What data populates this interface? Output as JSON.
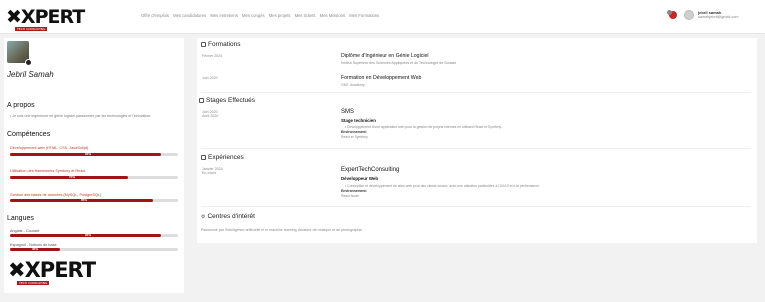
{
  "brand": {
    "logo_text": "XPERT",
    "logo_sub": "TECH CONSULTING"
  },
  "nav": {
    "items": [
      "Offre d'emplois",
      "Mes candidatures",
      "Mes entretiens",
      "Mes congés",
      "Mes projets",
      "Mes tickets",
      "Mes Missions",
      "Mes Formations"
    ]
  },
  "user": {
    "name": "jebril samah",
    "email": "samahjebril@gmail.com"
  },
  "profile": {
    "name": "Jebril Samah",
    "about_title": "A propos",
    "about_text": "Je suis une ingénieure en génie logiciel passionnée par les technologies et l'innovation.",
    "skills_title": "Compétences",
    "skills": [
      {
        "label": "Développement web (HTML, CSS, JavaScript)",
        "value": 90,
        "pct": "90%"
      },
      {
        "label": "Utilisation des frameworks Symfony et React",
        "value": 70,
        "pct": "70%"
      },
      {
        "label": "Gestion des bases de données (MySQL, PostgreSQL)",
        "value": 85,
        "pct": "85%"
      }
    ],
    "languages_title": "Langues",
    "languages": [
      {
        "label": "Anglais - Courant",
        "value": 90,
        "pct": "90%"
      },
      {
        "label": "Espagnol - Notions de base",
        "value": 30,
        "pct": "30%"
      }
    ]
  },
  "formations": {
    "title": "Formations",
    "items": [
      {
        "date": "Février 2024",
        "title": "Diplôme d'Ingénieur en Génie Logiciel",
        "place": "Institut Supérieur des Sciences Appliquées et de Technologie de Sousse"
      },
      {
        "date": "Juin 2020",
        "title": "Formation en Développement Web",
        "place": "GMT Academy"
      }
    ]
  },
  "stages": {
    "title": "Stages Effectués",
    "items": [
      {
        "date_start": "Juin 2020",
        "date_end": "Août 2020",
        "company": "SMS",
        "role": "Stage technicien",
        "desc": "Développement d'une application web pour la gestion de projets internes en utilisant React et Symfony.",
        "env_label": "Environnement:",
        "env": "React et Symfony"
      }
    ]
  },
  "experiences": {
    "title": "Expériences",
    "items": [
      {
        "date_start": "Janvier 2024",
        "date_end": "En cours",
        "company": "ExpertTechConsulting",
        "role": "Développeur Web",
        "desc": "Conception et développement de sites web pour des clients locaux, avec une attention particulière à l'UX/UI et à la performance.",
        "env_label": "Environnement:",
        "env": "React,Node"
      }
    ]
  },
  "interests": {
    "title": "Centres d'intérêt",
    "items": [
      "Passionné par l'intelligence artificielle et le machine learning",
      "Amateur de musique et de photographie"
    ]
  },
  "colors": {
    "accent": "#a31313",
    "bar_bg": "#dddddd"
  }
}
